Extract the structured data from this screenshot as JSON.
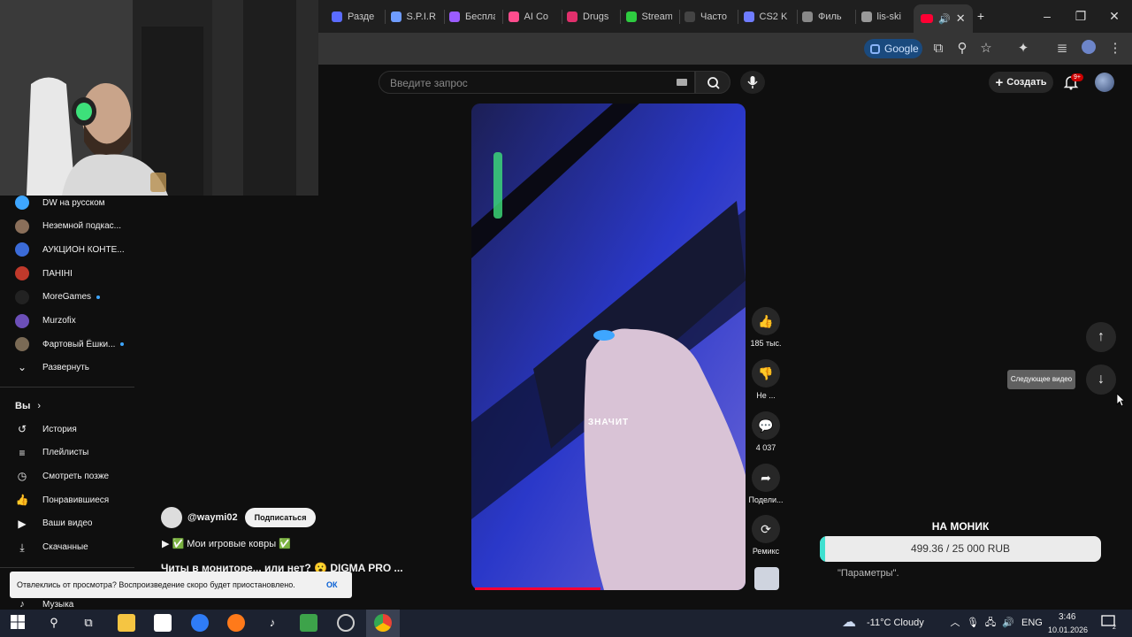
{
  "browser": {
    "tabs": [
      {
        "label": "Разде",
        "color": "#5b6cff"
      },
      {
        "label": "S.P.I.R",
        "color": "#6f9cff"
      },
      {
        "label": "Беспла",
        "color": "#9b5cff"
      },
      {
        "label": "AI Co",
        "color": "#ff4d8d"
      },
      {
        "label": "Drugs",
        "color": "#e1306c"
      },
      {
        "label": "Stream",
        "color": "#2ecc40"
      },
      {
        "label": "Часто",
        "color": "#444444"
      },
      {
        "label": "CS2 K",
        "color": "#6f7cff"
      },
      {
        "label": "Филь",
        "color": "#888888"
      },
      {
        "label": "lis-ski",
        "color": "#999999"
      }
    ],
    "active_tab_icon": "youtube-icon",
    "google_chip": "Google"
  },
  "youtube": {
    "search_placeholder": "Введите запрос",
    "create_label": "Создать",
    "notif_badge": "9+"
  },
  "sidebar": {
    "subscriptions": [
      {
        "label": "DW на русском",
        "color": "#3ea6ff",
        "live": false
      },
      {
        "label": "Неземной подкас...",
        "color": "#8a6f5a",
        "live": false
      },
      {
        "label": "АУКЦИОН КОНТЕ...",
        "color": "#3b6bd8",
        "live": false
      },
      {
        "label": "ПАНІНІ",
        "color": "#c0392b",
        "live": false
      },
      {
        "label": "MoreGames",
        "color": "#222222",
        "live": true
      },
      {
        "label": "Murzofix",
        "color": "#6c4fb8",
        "live": false
      },
      {
        "label": "Фартовый Ёшки...",
        "color": "#7a6a55",
        "live": true
      }
    ],
    "expand_label": "Развернуть",
    "you_label": "Вы",
    "you_items": [
      {
        "label": "История",
        "icon": "history-icon",
        "glyph": "↺"
      },
      {
        "label": "Плейлисты",
        "icon": "playlists-icon",
        "glyph": "≡"
      },
      {
        "label": "Смотреть позже",
        "icon": "clock-icon",
        "glyph": "◷"
      },
      {
        "label": "Понравившиеся",
        "icon": "thumb-up-icon",
        "glyph": "👍"
      },
      {
        "label": "Ваши видео",
        "icon": "your-videos-icon",
        "glyph": "▶"
      },
      {
        "label": "Скачанные",
        "icon": "download-icon",
        "glyph": "⤓"
      }
    ],
    "music_label": "Музыка"
  },
  "short": {
    "caption": "ЗНАЧИТ",
    "channel": "@waymi02",
    "subscribe_label": "Подписаться",
    "description": "▶ ✅ Мои игровые ковры ✅",
    "title": "Читы в мониторе... или нет? 😮 DIGMA PRO ...",
    "progress": 0.48,
    "actions": {
      "likes": "185 тыс.",
      "dislike": "Не ...",
      "comments": "4 037",
      "share": "Подели...",
      "remix": "Ремикс"
    },
    "next_tooltip": "Следующее видео"
  },
  "toast": {
    "message": "Отвлеклись от просмотра? Воспроизведение скоро будет приостановлено.",
    "ok_label": "ОК"
  },
  "donation": {
    "title": "НА МОНИК",
    "progress_text": "499.36 / 25 000 RUB",
    "current": 499.36,
    "goal": 25000,
    "params_text": "\"Параметры\"."
  },
  "taskbar": {
    "weather": "-11°C  Cloudy",
    "lang": "ENG",
    "time": "3:46",
    "date": "10.01.2026",
    "notifications": "2"
  }
}
